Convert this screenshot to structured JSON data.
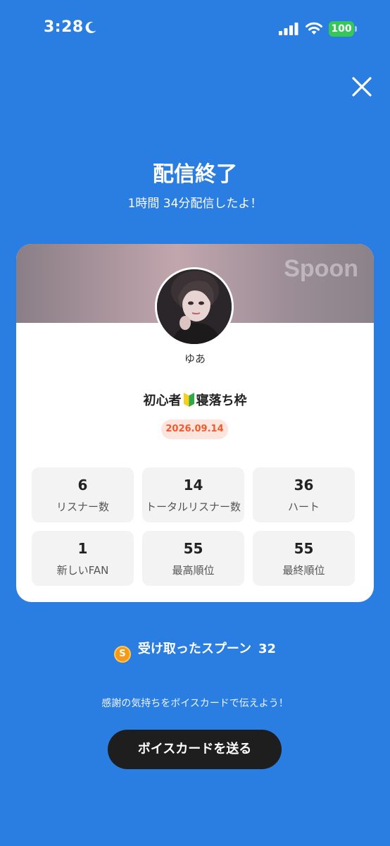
{
  "status_bar": {
    "time": "3:28",
    "battery_level": "100",
    "icons": [
      "moon-icon",
      "signal-icon",
      "wifi-icon",
      "battery-icon"
    ]
  },
  "header": {
    "title": "配信終了",
    "subtitle": "1時間 34分配信したよ！",
    "close_icon": "close-icon"
  },
  "card": {
    "brand": "Spoon",
    "username": "ゆあ",
    "title_prefix": "初心者",
    "title_suffix": "寝落ち枠",
    "title_icon": "beginner-mark-icon",
    "date": "2026.09.14",
    "stats": [
      {
        "value": "6",
        "label": "リスナー数"
      },
      {
        "value": "14",
        "label": "トータルリスナー数"
      },
      {
        "value": "36",
        "label": "ハート"
      },
      {
        "value": "1",
        "label": "新しいFAN"
      },
      {
        "value": "55",
        "label": "最高順位"
      },
      {
        "value": "55",
        "label": "最終順位"
      }
    ]
  },
  "spoons": {
    "icon": "spoon-coin-icon",
    "icon_letter": "S",
    "label": "受け取ったスプーン",
    "count": "32"
  },
  "footer": {
    "message": "感謝の気持ちをボイスカードで伝えよう！",
    "button_label": "ボイスカードを送る"
  },
  "colors": {
    "background": "#2a7de1",
    "date_badge_text": "#ef5a2e",
    "button_bg": "#1e1e1e",
    "battery": "#36c759"
  }
}
